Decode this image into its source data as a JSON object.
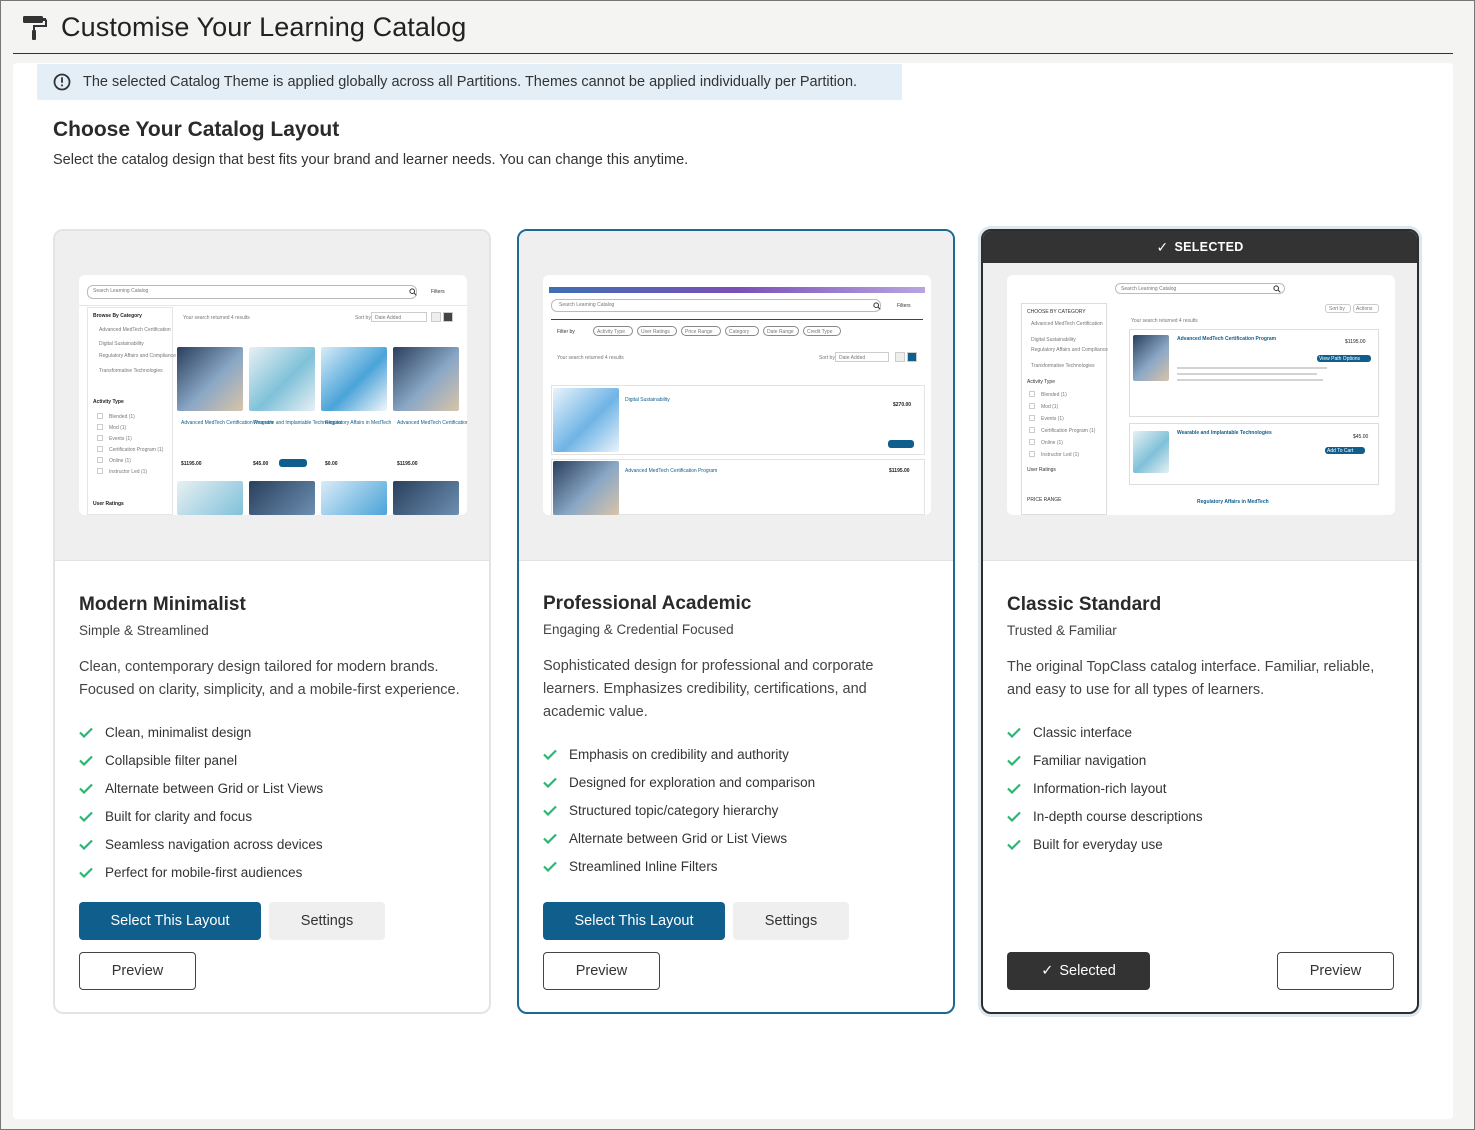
{
  "header": {
    "title": "Customise Your Learning Catalog",
    "icon": "paint-roller-icon"
  },
  "notice": {
    "text": "The selected Catalog Theme is applied globally across all Partitions. Themes cannot be applied individually per Partition.",
    "icon": "info-icon"
  },
  "section": {
    "title": "Choose Your Catalog Layout",
    "subtitle": "Select the catalog design that best fits your brand and learner needs. You can change this anytime."
  },
  "colors": {
    "primary": "#0f5e8c",
    "check": "#2bb673",
    "dark": "#333333",
    "notice_bg": "#e3eef7"
  },
  "cards": [
    {
      "title": "Modern Minimalist",
      "tagline": "Simple & Streamlined",
      "description": "Clean, contemporary design tailored for modern brands. Focused on clarity, simplicity, and a mobile-first experience.",
      "features": [
        "Clean, minimalist design",
        "Collapsible filter panel",
        "Alternate between Grid or List Views",
        "Built for clarity and focus",
        "Seamless navigation across devices",
        "Perfect for mobile-first audiences"
      ],
      "select_label": "Select This Layout",
      "settings_label": "Settings",
      "preview_label": "Preview"
    },
    {
      "title": "Professional Academic",
      "tagline": "Engaging & Credential Focused",
      "description": "Sophisticated design for professional and corporate learners. Emphasizes credibility, certifications, and academic value.",
      "features": [
        "Emphasis on credibility and authority",
        "Designed for exploration and comparison",
        "Structured topic/category hierarchy",
        "Alternate between Grid or List Views",
        "Streamlined Inline Filters"
      ],
      "select_label": "Select This Layout",
      "settings_label": "Settings",
      "preview_label": "Preview"
    },
    {
      "title": "Classic Standard",
      "tagline": "Trusted & Familiar",
      "description": "The original TopClass catalog interface. Familiar, reliable, and easy to use for all types of learners.",
      "features": [
        "Classic interface",
        "Familiar navigation",
        "Information-rich layout",
        "In-depth course descriptions",
        "Built for everyday use"
      ],
      "banner_label": "SELECTED",
      "selected_label": "Selected",
      "preview_label": "Preview"
    }
  ],
  "mini": {
    "search_placeholder": "Search Learning Catalog",
    "filters": "Filters",
    "browse": "Browse By Category",
    "activity_type": "Activity Type",
    "user_ratings": "User Ratings",
    "sort_by": "Sort by",
    "date_added": "Date Added",
    "results": "Your search returned 4 results",
    "course1": "Advanced MedTech Certification Program",
    "course2": "Wearable and Implantable Technologies",
    "course3": "Regulatory Affairs in MedTech",
    "course4": "Digital Sustainability",
    "price1": "$1195.00",
    "price2": "$45.00",
    "price3": "$0.00",
    "price4": "$270.00",
    "add_to_cart": "Add To Cart",
    "view_path": "View Path Options",
    "filter_by": "Filter by",
    "filter_chips": [
      "Activity Type",
      "User Ratings",
      "Price Range",
      "Category",
      "Date Range",
      "Credit Type"
    ],
    "choose_category": "CHOOSE BY CATEGORY",
    "cat_items": [
      "Advanced MedTech Certification",
      "Digital Sustainability",
      "Regulatory Affairs and Compliance",
      "Transformative Technologies"
    ],
    "act_items": [
      "Blended (1)",
      "Mod (1)",
      "Events (1)",
      "Certification Program (1)",
      "Online (1)",
      "Instructor Led (1)"
    ],
    "price_range": "PRICE RANGE",
    "actions": "Actions",
    "tag_badge": "CERTIFICATION PROGRAM"
  }
}
